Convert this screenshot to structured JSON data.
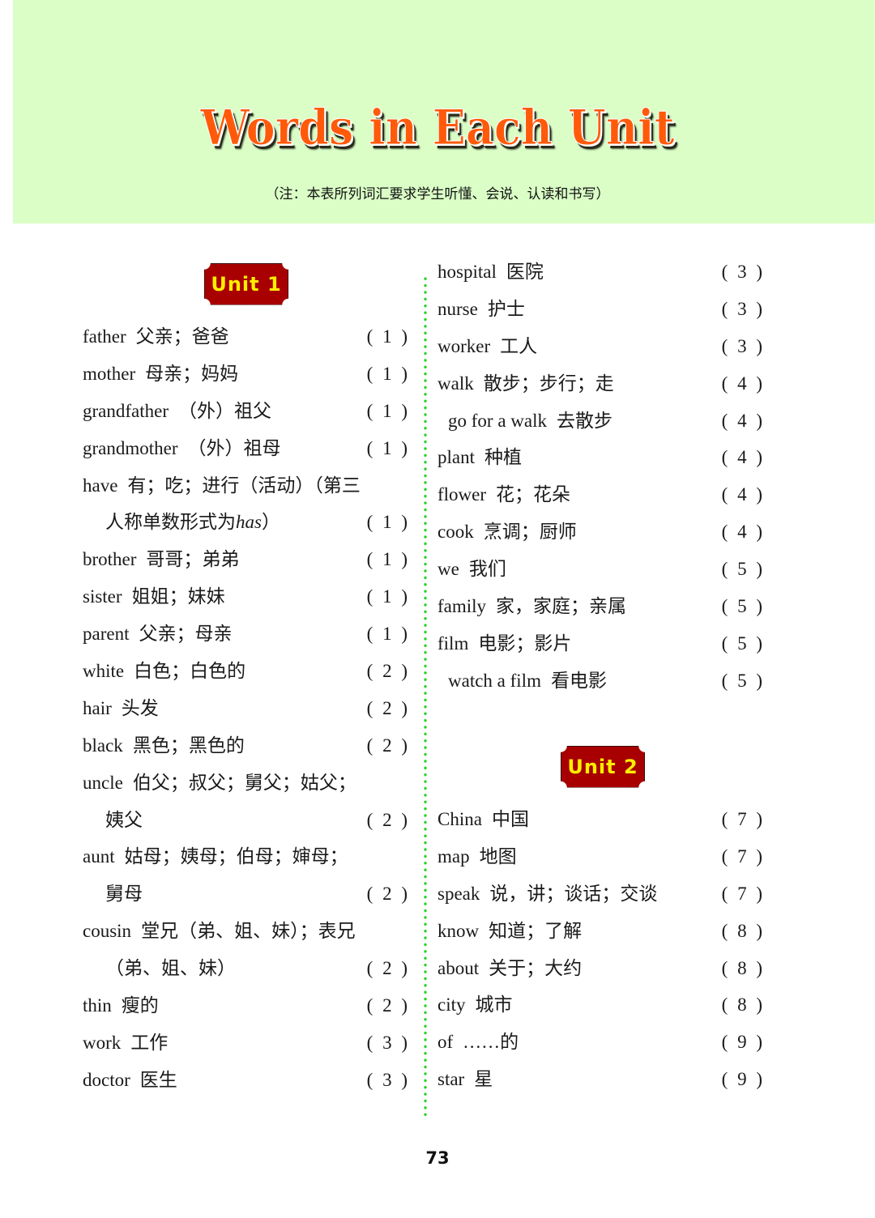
{
  "header": {
    "title": "Words in Each Unit",
    "note": "（注：本表所列词汇要求学生听懂、会说、认读和书写）"
  },
  "colors": {
    "header_background": "#dafec6",
    "title_color": "#ff5a0a",
    "badge_background": "#a80000",
    "badge_text": "#ffee00",
    "divider_dots": "#2ad12a"
  },
  "units": [
    {
      "label": "Unit 1"
    },
    {
      "label": "Unit 2"
    }
  ],
  "left_column": [
    {
      "en": "father",
      "zh": "父亲；爸爸",
      "num": "( 1 )"
    },
    {
      "en": "mother",
      "zh": "母亲；妈妈",
      "num": "( 1 )"
    },
    {
      "en": "grandfather",
      "zh": "（外）祖父",
      "num": "( 1 )"
    },
    {
      "en": "grandmother",
      "zh": "（外）祖母",
      "num": "( 1 )"
    },
    {
      "en": "have",
      "zh": "有；吃；进行（活动）（第三",
      "num": ""
    },
    {
      "en": "",
      "zh": "人称单数形式为",
      "zh_italic": "has",
      "zh_after": "）",
      "num": "( 1 )"
    },
    {
      "en": "brother",
      "zh": "哥哥；弟弟",
      "num": "( 1 )"
    },
    {
      "en": "sister",
      "zh": "姐姐；妹妹",
      "num": "( 1 )"
    },
    {
      "en": "parent",
      "zh": "父亲；母亲",
      "num": "( 1 )"
    },
    {
      "en": "white",
      "zh": "白色；白色的",
      "num": "( 2 )"
    },
    {
      "en": "hair",
      "zh": "头发",
      "num": "( 2 )"
    },
    {
      "en": "black",
      "zh": "黑色；黑色的",
      "num": "( 2 )"
    },
    {
      "en": "uncle",
      "zh": "伯父；叔父；舅父；姑父；",
      "num": ""
    },
    {
      "en": "",
      "zh": "姨父",
      "num": "( 2 )"
    },
    {
      "en": "aunt",
      "zh": "姑母；姨母；伯母；婶母；",
      "num": ""
    },
    {
      "en": "",
      "zh": "舅母",
      "num": "( 2 )"
    },
    {
      "en": "cousin",
      "zh": "堂兄（弟、姐、妹）；表兄",
      "num": ""
    },
    {
      "en": "",
      "zh": "（弟、姐、妹）",
      "num": "( 2 )"
    },
    {
      "en": "thin",
      "zh": "瘦的",
      "num": "( 2 )"
    },
    {
      "en": "work",
      "zh": "工作",
      "num": "( 3 )"
    },
    {
      "en": "doctor",
      "zh": "医生",
      "num": "( 3 )"
    }
  ],
  "right_column_unit1": [
    {
      "en": "hospital",
      "zh": "医院",
      "num": "( 3 )"
    },
    {
      "en": "nurse",
      "zh": "护士",
      "num": "( 3 )"
    },
    {
      "en": "worker",
      "zh": "工人",
      "num": "( 3 )"
    },
    {
      "en": "walk",
      "zh": "散步；步行；走",
      "num": "( 4 )"
    },
    {
      "en": "go for a walk",
      "zh": "去散步",
      "num": "( 4 )"
    },
    {
      "en": "plant",
      "zh": "种植",
      "num": "( 4 )"
    },
    {
      "en": "flower",
      "zh": "花；花朵",
      "num": "( 4 )"
    },
    {
      "en": "cook",
      "zh": "烹调；厨师",
      "num": "( 4 )"
    },
    {
      "en": "we",
      "zh": "我们",
      "num": "( 5 )"
    },
    {
      "en": "family",
      "zh": "家，家庭；亲属",
      "num": "( 5 )"
    },
    {
      "en": "film",
      "zh": "电影；影片",
      "num": "( 5 )"
    },
    {
      "en": "watch a film",
      "zh": "看电影",
      "num": "( 5 )"
    }
  ],
  "right_column_unit2": [
    {
      "en": "China",
      "zh": "中国",
      "num": "( 7 )"
    },
    {
      "en": "map",
      "zh": "地图",
      "num": "( 7 )"
    },
    {
      "en": "speak",
      "zh": "说，讲；谈话；交谈",
      "num": "( 7 )"
    },
    {
      "en": "know",
      "zh": "知道；了解",
      "num": "( 8 )"
    },
    {
      "en": "about",
      "zh": "关于；大约",
      "num": "( 8 )"
    },
    {
      "en": "city",
      "zh": "城市",
      "num": "( 8 )"
    },
    {
      "en": "of",
      "zh": "……的",
      "num": "( 9 )"
    },
    {
      "en": "star",
      "zh": "星",
      "num": "( 9 )"
    }
  ],
  "footer": {
    "page_number": "73"
  }
}
